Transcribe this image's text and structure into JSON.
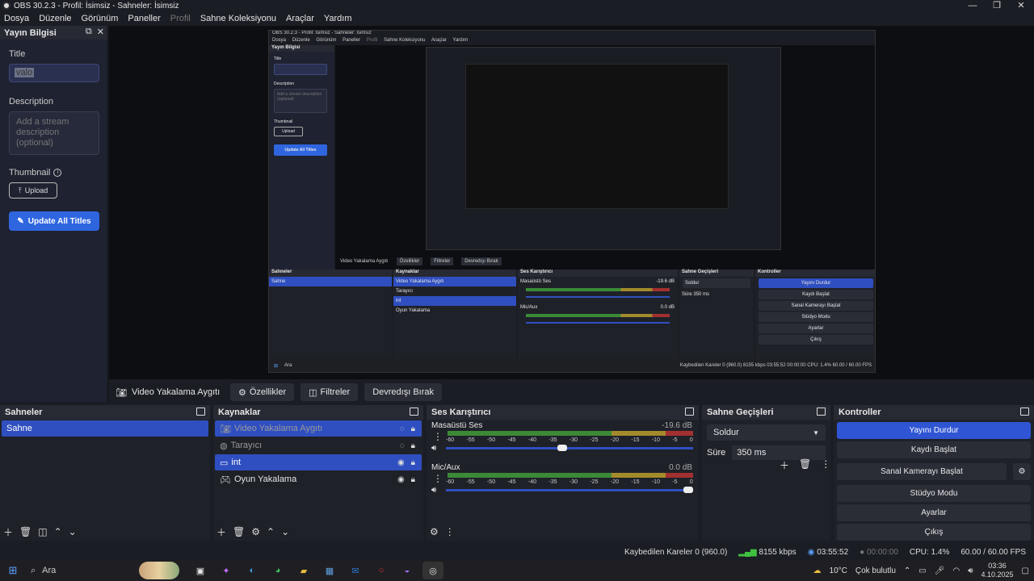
{
  "window": {
    "title": "OBS 30.2.3 - Profil: İsimsiz - Sahneler: İsimsiz"
  },
  "menu": [
    "Dosya",
    "Düzenle",
    "Görünüm",
    "Paneller",
    "Profil",
    "Sahne Koleksiyonu",
    "Araçlar",
    "Yardım"
  ],
  "stream_info": {
    "header": "Yayın Bilgisi",
    "title_label": "Title",
    "title_value": "valo",
    "description_label": "Description",
    "description_placeholder": "Add a stream description (optional)",
    "thumbnail_label": "Thumbnail",
    "upload_label": "Upload",
    "update_label": "Update All Titles"
  },
  "nested": {
    "title": "OBS 30.2.3 - Profil: İsimsiz - Sahneler: İsimsiz",
    "menu": [
      "Dosya",
      "Düzenle",
      "Görünüm",
      "Paneller",
      "Profil",
      "Sahne Koleksiyonu",
      "Araçlar",
      "Yardım"
    ],
    "controls_row": [
      "Video Yakalama Aygıtı",
      "Özellikler",
      "Filtreler",
      "Devredışı Bırak"
    ],
    "panels": {
      "scenes": "Sahneler",
      "sources": "Kaynaklar",
      "mixer": "Ses Karıştırıcı",
      "transitions": "Sahne Geçişleri",
      "controls": "Kontroller"
    },
    "scene": "Sahne",
    "sources": [
      "Video Yakalama Aygıtı",
      "Tarayıcı",
      "int",
      "Oyun Yakalama"
    ],
    "mixer": [
      {
        "name": "Masaüstü Ses",
        "db": "-19.6 dB"
      },
      {
        "name": "Mic/Aux",
        "db": "0.0 dB"
      }
    ],
    "transition": "Soldur",
    "duration_label": "Süre",
    "duration": "350 ms",
    "buttons": [
      "Yayını Durdur",
      "Kaydı Başlat",
      "Sanal Kamerayı Başlat",
      "Stüdyo Modu",
      "Ayarlar",
      "Çıkış"
    ],
    "status": "Kaybedilen Kareler 0 (960.0)   8155 kbps   03:55:52   00:00:00   CPU: 1.4%   60.00 / 60.00 FPS",
    "search": "Ara"
  },
  "source_controls": {
    "source": "Video Yakalama Aygıtı",
    "properties": "Özellikler",
    "filters": "Filtreler",
    "deactivate": "Devredışı Bırak"
  },
  "scenes": {
    "header": "Sahneler",
    "items": [
      "Sahne"
    ]
  },
  "sources": {
    "header": "Kaynaklar",
    "items": [
      {
        "name": "Video Yakalama Aygıtı",
        "icon": "camera-icon",
        "visible": false,
        "selected": true
      },
      {
        "name": "Tarayıcı",
        "icon": "globe-icon",
        "visible": false,
        "selected": false
      },
      {
        "name": "int",
        "icon": "monitor-icon",
        "visible": true,
        "selected": true
      },
      {
        "name": "Oyun Yakalama",
        "icon": "gamepad-icon",
        "visible": true,
        "selected": false
      }
    ]
  },
  "mixer": {
    "header": "Ses Karıştırıcı",
    "scale": [
      "-60",
      "-55",
      "-50",
      "-45",
      "-40",
      "-35",
      "-30",
      "-25",
      "-20",
      "-15",
      "-10",
      "-5",
      "0"
    ],
    "channels": [
      {
        "name": "Masaüstü Ses",
        "db": "-19.6 dB",
        "volume": 0.49
      },
      {
        "name": "Mic/Aux",
        "db": "0.0 dB",
        "volume": 1.0
      }
    ]
  },
  "transitions": {
    "header": "Sahne Geçişleri",
    "selected": "Soldur",
    "duration_label": "Süre",
    "duration": "350 ms"
  },
  "controls": {
    "header": "Kontroller",
    "buttons": [
      "Yayını Durdur",
      "Kaydı Başlat",
      "Sanal Kamerayı Başlat",
      "Stüdyo Modu",
      "Ayarlar",
      "Çıkış"
    ]
  },
  "status": {
    "dropped": "Kaybedilen Kareler 0 (960.0)",
    "bitrate": "8155 kbps",
    "stream_time": "03:55:52",
    "rec_time": "00:00:00",
    "cpu": "CPU: 1.4%",
    "fps": "60.00 / 60.00 FPS"
  },
  "taskbar": {
    "search": "Ara",
    "weather": "10°C",
    "weather_text": "Çok bulutlu",
    "time": "03:36",
    "date": "4.10.2025"
  }
}
